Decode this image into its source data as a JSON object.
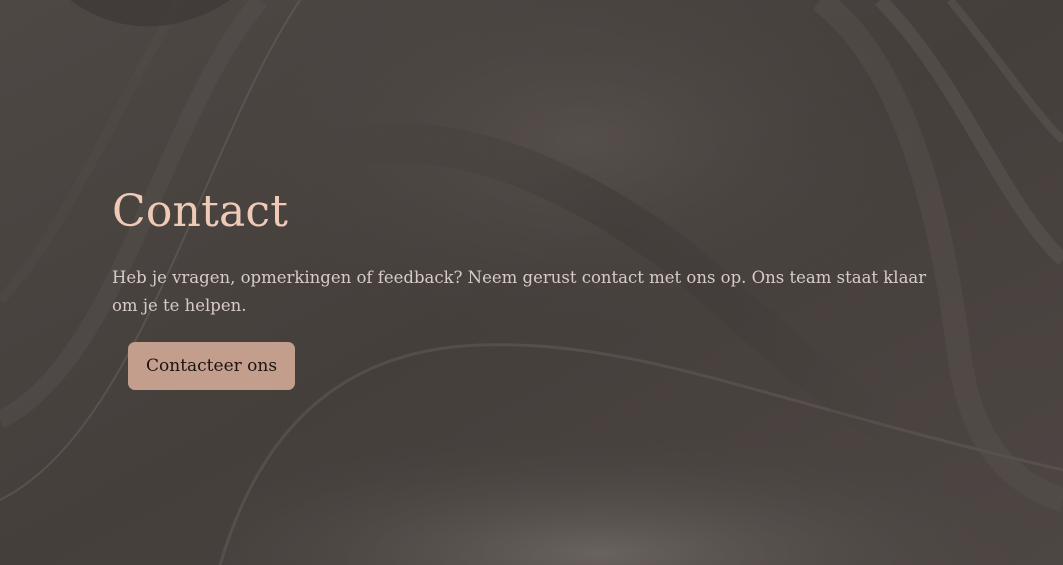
{
  "hero": {
    "title": "Contact",
    "description": "Heb je vragen, opmerkingen of feedback? Neem gerust contact met ons op. Ons team staat klaar om je te helpen.",
    "cta_label": "Contacteer ons"
  },
  "colors": {
    "background": "#4a4441",
    "title": "#efcab6",
    "text": "#d8cbc5",
    "button": "#c39e8d",
    "button_text": "#1b1411"
  }
}
